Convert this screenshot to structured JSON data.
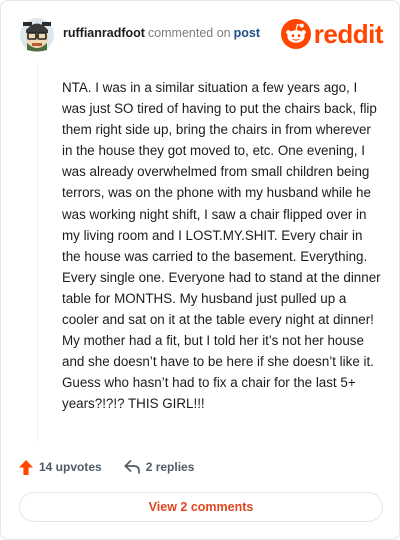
{
  "comment": {
    "username": "ruffianradfoot",
    "action_text": "commented on",
    "target_link": "post",
    "body": "NTA. I was in a similar situation a few years ago, I was just SO tired of having to put the chairs back, flip them right side up, bring the chairs in from wherever in the house they got moved to, etc. One evening, I was already overwhelmed from small children being terrors, was on the phone with my husband while he was working night shift, I saw a chair flipped over in my living room and I LOST.MY.SHIT. Every chair in the house was carried to the basement. Everything. Every single one. Everyone had to stand at the dinner table for MONTHS. My husband just pulled up a cooler and sat on it at the table every night at dinner! My mother had a fit, but I told her it’s not her house and she doesn’t have to be here if she doesn’t like it. Guess who hasn’t had to fix a chair for the last 5+ years?!?!? THIS GIRL!!!"
  },
  "logo": {
    "wordmark": "reddit",
    "icon": "reddit-snoo-icon"
  },
  "actions": {
    "upvotes_label": "14 upvotes",
    "replies_label": "2 replies",
    "upvote_icon": "upvote-arrow-icon",
    "reply_icon": "reply-arrow-icon"
  },
  "view_comments_label": "View 2 comments",
  "colors": {
    "brand_orange": "#ff4500",
    "link_blue": "#1f4d8a",
    "action_gray": "#4f5b66",
    "button_text": "#e0461f"
  }
}
